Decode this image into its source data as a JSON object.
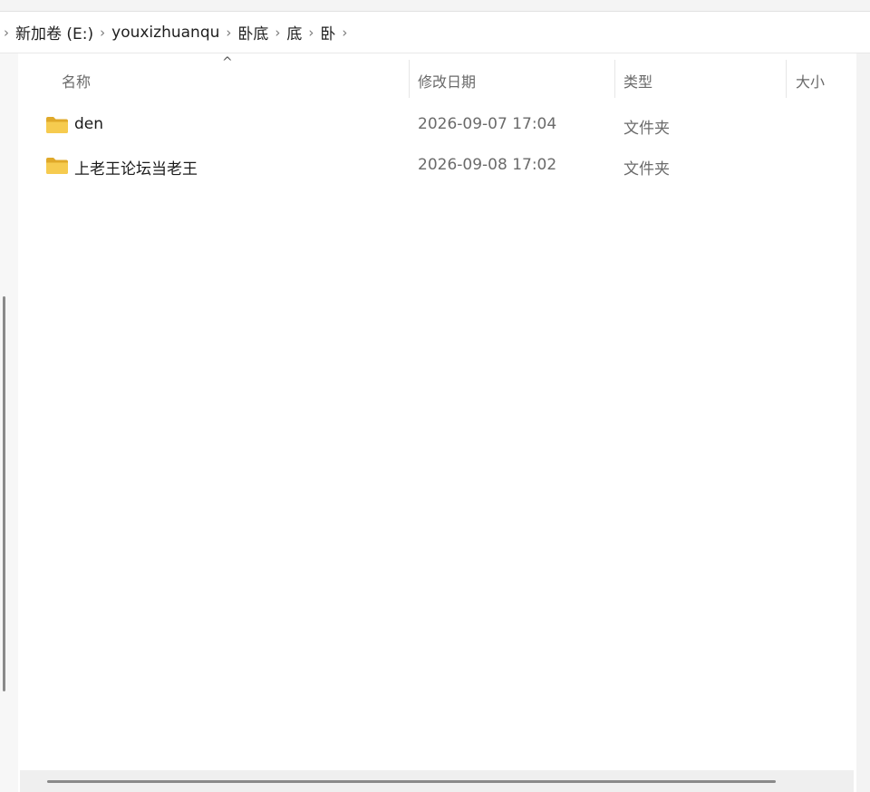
{
  "breadcrumb": {
    "items": [
      "新加卷 (E:)",
      "youxizhuanqu",
      "卧底",
      "底",
      "卧"
    ],
    "separator": "›"
  },
  "columns": {
    "name": "名称",
    "date_modified": "修改日期",
    "type": "类型",
    "size": "大小",
    "sort_indicator": "^"
  },
  "files": [
    {
      "name": "den",
      "date_modified": "2026-09-07 17:04",
      "type": "文件夹",
      "icon": "folder-icon"
    },
    {
      "name": "上老王论坛当老王",
      "date_modified": "2026-09-08 17:02",
      "type": "文件夹",
      "icon": "folder-icon"
    }
  ],
  "colors": {
    "folder": "#f4c542",
    "folder_dark": "#e0a92a",
    "header_text": "#6a6a6a",
    "scrollbar_thumb": "#8a8a8a"
  }
}
